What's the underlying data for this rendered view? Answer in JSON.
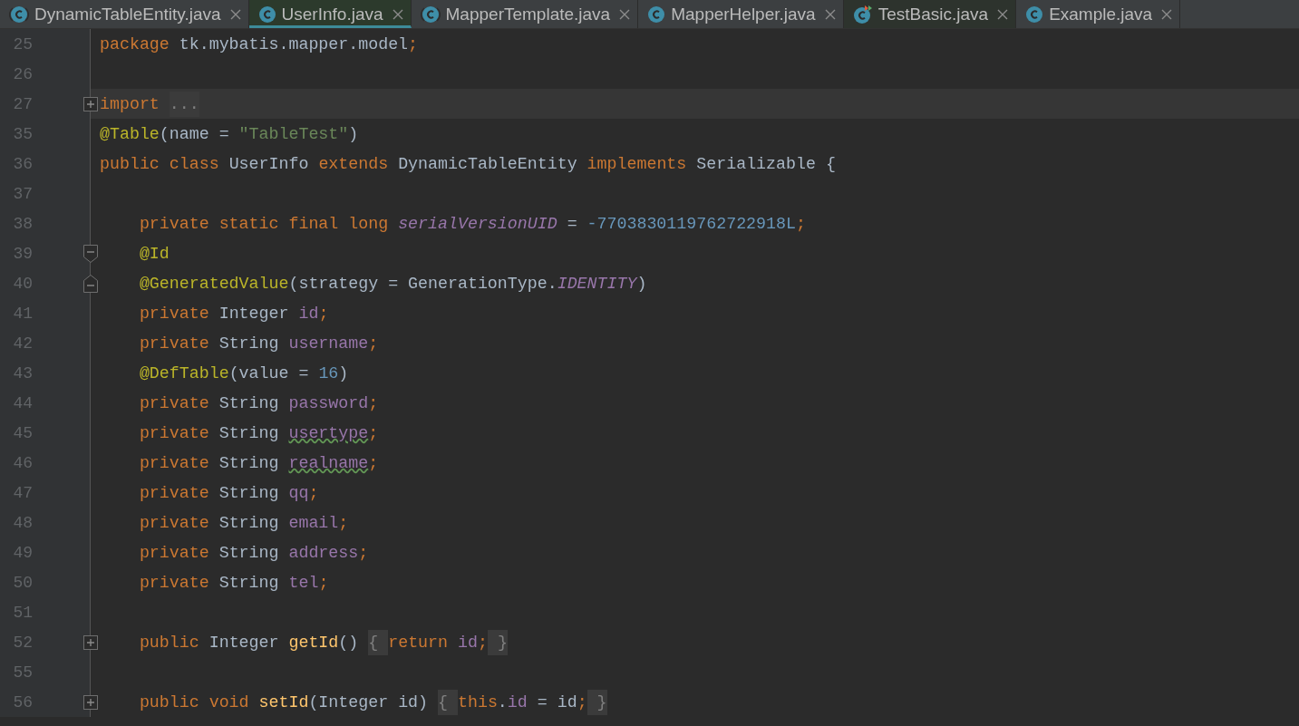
{
  "tabs": [
    {
      "label": "DynamicTableEntity.java",
      "kind": "abstract",
      "selected": false,
      "emphasized": false
    },
    {
      "label": "UserInfo.java",
      "kind": "class",
      "selected": true,
      "emphasized": false
    },
    {
      "label": "MapperTemplate.java",
      "kind": "abstract",
      "selected": false,
      "emphasized": false
    },
    {
      "label": "MapperHelper.java",
      "kind": "class",
      "selected": false,
      "emphasized": false
    },
    {
      "label": "TestBasic.java",
      "kind": "test",
      "selected": false,
      "emphasized": true
    },
    {
      "label": "Example.java",
      "kind": "class",
      "selected": false,
      "emphasized": false
    }
  ],
  "lines": [
    {
      "number": "25",
      "kind": "plain",
      "tokens": [
        {
          "kind": "kw",
          "t": "package"
        },
        {
          "kind": "plain",
          "t": " tk.mybatis.mapper.model"
        },
        {
          "kind": "kw",
          "t": ";"
        }
      ]
    },
    {
      "number": "26",
      "kind": "plain"
    },
    {
      "number": "27",
      "kind": "expand",
      "current": true,
      "tokens": [
        {
          "kind": "kw",
          "t": "import "
        },
        {
          "kind": "folded",
          "t": "..."
        }
      ]
    },
    {
      "number": "35",
      "kind": "plain",
      "tokens": [
        {
          "kind": "ann",
          "t": "@Table"
        },
        {
          "kind": "plain",
          "t": "(name = "
        },
        {
          "kind": "str",
          "t": "\"TableTest\""
        },
        {
          "kind": "plain",
          "t": ")"
        }
      ]
    },
    {
      "number": "36",
      "kind": "plain",
      "tokens": [
        {
          "kind": "kw",
          "t": "public class "
        },
        {
          "kind": "plain",
          "t": "UserInfo "
        },
        {
          "kind": "kw",
          "t": "extends "
        },
        {
          "kind": "plain",
          "t": "DynamicTableEntity "
        },
        {
          "kind": "kw",
          "t": "implements "
        },
        {
          "kind": "plain",
          "t": "Serializable {"
        }
      ]
    },
    {
      "number": "37",
      "kind": "plain"
    },
    {
      "number": "38",
      "kind": "plain",
      "tokens": [
        {
          "kind": "kw",
          "t": "    private static final long "
        },
        {
          "kind": "static",
          "t": "serialVersionUID"
        },
        {
          "kind": "plain",
          "t": " = "
        },
        {
          "kind": "num",
          "t": "-7703830119762722918L"
        },
        {
          "kind": "kw",
          "t": ";"
        }
      ]
    },
    {
      "number": "39",
      "kind": "collapse-start",
      "tokens": [
        {
          "kind": "ann",
          "t": "    @Id"
        }
      ]
    },
    {
      "number": "40",
      "kind": "collapse-end",
      "tokens": [
        {
          "kind": "ann",
          "t": "    @GeneratedValue"
        },
        {
          "kind": "plain",
          "t": "(strategy = GenerationType."
        },
        {
          "kind": "static",
          "t": "IDENTITY"
        },
        {
          "kind": "plain",
          "t": ")"
        }
      ]
    },
    {
      "number": "41",
      "kind": "plain",
      "tokens": [
        {
          "kind": "kw",
          "t": "    private "
        },
        {
          "kind": "plain",
          "t": "Integer "
        },
        {
          "kind": "field",
          "t": "id"
        },
        {
          "kind": "kw",
          "t": ";"
        }
      ]
    },
    {
      "number": "42",
      "kind": "plain",
      "tokens": [
        {
          "kind": "kw",
          "t": "    private "
        },
        {
          "kind": "plain",
          "t": "String "
        },
        {
          "kind": "field",
          "t": "username"
        },
        {
          "kind": "kw",
          "t": ";"
        }
      ]
    },
    {
      "number": "43",
      "kind": "plain",
      "tokens": [
        {
          "kind": "ann",
          "t": "    @DefTable"
        },
        {
          "kind": "plain",
          "t": "(value = "
        },
        {
          "kind": "num",
          "t": "16"
        },
        {
          "kind": "plain",
          "t": ")"
        }
      ]
    },
    {
      "number": "44",
      "kind": "plain",
      "tokens": [
        {
          "kind": "kw",
          "t": "    private "
        },
        {
          "kind": "plain",
          "t": "String "
        },
        {
          "kind": "field",
          "t": "password"
        },
        {
          "kind": "kw",
          "t": ";"
        }
      ]
    },
    {
      "number": "45",
      "kind": "plain",
      "tokens": [
        {
          "kind": "kw",
          "t": "    private "
        },
        {
          "kind": "plain",
          "t": "String "
        },
        {
          "kind": "typo",
          "t": "usertype"
        },
        {
          "kind": "kw",
          "t": ";"
        }
      ]
    },
    {
      "number": "46",
      "kind": "plain",
      "tokens": [
        {
          "kind": "kw",
          "t": "    private "
        },
        {
          "kind": "plain",
          "t": "String "
        },
        {
          "kind": "typo",
          "t": "realname"
        },
        {
          "kind": "kw",
          "t": ";"
        }
      ]
    },
    {
      "number": "47",
      "kind": "plain",
      "tokens": [
        {
          "kind": "kw",
          "t": "    private "
        },
        {
          "kind": "plain",
          "t": "String "
        },
        {
          "kind": "field",
          "t": "qq"
        },
        {
          "kind": "kw",
          "t": ";"
        }
      ]
    },
    {
      "number": "48",
      "kind": "plain",
      "tokens": [
        {
          "kind": "kw",
          "t": "    private "
        },
        {
          "kind": "plain",
          "t": "String "
        },
        {
          "kind": "field",
          "t": "email"
        },
        {
          "kind": "kw",
          "t": ";"
        }
      ]
    },
    {
      "number": "49",
      "kind": "plain",
      "tokens": [
        {
          "kind": "kw",
          "t": "    private "
        },
        {
          "kind": "plain",
          "t": "String "
        },
        {
          "kind": "field",
          "t": "address"
        },
        {
          "kind": "kw",
          "t": ";"
        }
      ]
    },
    {
      "number": "50",
      "kind": "plain",
      "tokens": [
        {
          "kind": "kw",
          "t": "    private "
        },
        {
          "kind": "plain",
          "t": "String "
        },
        {
          "kind": "field",
          "t": "tel"
        },
        {
          "kind": "kw",
          "t": ";"
        }
      ]
    },
    {
      "number": "51",
      "kind": "plain"
    },
    {
      "number": "52",
      "kind": "expand",
      "tokens": [
        {
          "kind": "kw",
          "t": "    public "
        },
        {
          "kind": "plain",
          "t": "Integer "
        },
        {
          "kind": "method",
          "t": "getId"
        },
        {
          "kind": "plain",
          "t": "() "
        },
        {
          "kind": "folded",
          "t": "{ "
        },
        {
          "kind": "kw",
          "t": "return "
        },
        {
          "kind": "field",
          "t": "id"
        },
        {
          "kind": "kw",
          "t": ";"
        },
        {
          "kind": "folded",
          "t": " }"
        }
      ]
    },
    {
      "number": "55",
      "kind": "plain"
    },
    {
      "number": "56",
      "kind": "expand",
      "tokens": [
        {
          "kind": "kw",
          "t": "    public void "
        },
        {
          "kind": "method",
          "t": "setId"
        },
        {
          "kind": "plain",
          "t": "(Integer id) "
        },
        {
          "kind": "folded",
          "t": "{ "
        },
        {
          "kind": "kw",
          "t": "this"
        },
        {
          "kind": "plain",
          "t": "."
        },
        {
          "kind": "field",
          "t": "id"
        },
        {
          "kind": "plain",
          "t": " = id"
        },
        {
          "kind": "kw",
          "t": ";"
        },
        {
          "kind": "folded",
          "t": " }"
        }
      ]
    }
  ]
}
